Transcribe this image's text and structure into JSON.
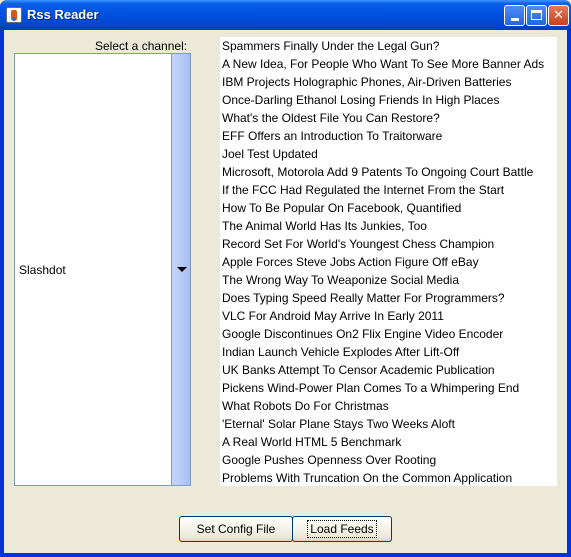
{
  "window": {
    "title": "Rss Reader",
    "icon": "rss-app-icon",
    "controls": [
      "minimize-icon",
      "maximize-icon",
      "close-icon"
    ]
  },
  "channel": {
    "label": "Select a channel:",
    "selected": "Slashdot"
  },
  "feeds": [
    "Spammers Finally Under the Legal Gun?",
    "A New Idea, For People Who Want To See More Banner Ads",
    "IBM Projects Holographic Phones, Air-Driven Batteries",
    "Once-Darling Ethanol Losing Friends In High Places",
    "What's the Oldest File You Can Restore?",
    "EFF Offers an Introduction To Traitorware",
    "Joel Test Updated",
    "Microsoft, Motorola Add 9 Patents To Ongoing Court Battle",
    "If the FCC Had Regulated the Internet From the Start",
    "How To Be Popular On Facebook, Quantified",
    "The Animal World Has Its Junkies, Too",
    "Record Set For World's Youngest Chess Champion",
    "Apple Forces Steve Jobs Action Figure Off eBay",
    "The Wrong Way To Weaponize Social Media",
    "Does Typing Speed Really Matter For Programmers?",
    "VLC For Android May Arrive In Early 2011",
    "Google Discontinues On2 Flix Engine Video Encoder",
    "Indian Launch Vehicle Explodes After Lift-Off",
    "UK Banks Attempt To Censor Academic Publication",
    "Pickens Wind-Power Plan Comes To a Whimpering End",
    "What Robots Do For Christmas",
    "'Eternal' Solar Plane Stays Two Weeks Aloft",
    "A Real World HTML 5 Benchmark",
    "Google Pushes Openness Over Rooting",
    "Problems With Truncation On the Common Application"
  ],
  "buttons": {
    "config": "Set Config File",
    "load": "Load Feeds"
  }
}
